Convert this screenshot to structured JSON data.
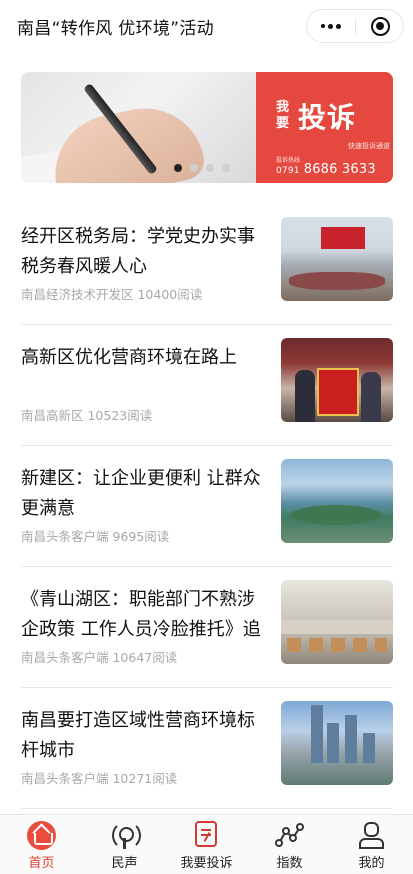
{
  "header": {
    "title": "南昌“转作风 优环境”活动"
  },
  "banner": {
    "wo_yao": "我要",
    "tousu": "投诉",
    "subtitle": "快速投诉通道",
    "hotline_label": "投诉热线",
    "area_code": "0791",
    "phone": "8686 3633",
    "carousel_total": 4,
    "carousel_active": 1
  },
  "news": [
    {
      "title": "经开区税务局：学党史办实事 税务春风暖人心",
      "meta": "南昌经济技术开发区 10400阅读"
    },
    {
      "title": "高新区优化营商环境在路上",
      "meta": "南昌高新区 10523阅读"
    },
    {
      "title": "新建区：让企业更便利 让群众更满意",
      "meta": "南昌头条客户端 9695阅读"
    },
    {
      "title": "《青山湖区：职能部门不熟涉企政策 工作人员冷脸推托》追",
      "meta": "南昌头条客户端 10647阅读"
    },
    {
      "title": "南昌要打造区域性营商环境标杆城市",
      "meta": "南昌头条客户端 10271阅读"
    }
  ],
  "tabbar": {
    "tabs": [
      {
        "label": "首页",
        "icon": "home-icon"
      },
      {
        "label": "民声",
        "icon": "broadcast-icon"
      },
      {
        "label": "我要投诉",
        "icon": "complaint-form-icon"
      },
      {
        "label": "指数",
        "icon": "index-chart-icon"
      },
      {
        "label": "我的",
        "icon": "profile-icon"
      }
    ],
    "active_index": 0
  },
  "colors": {
    "accent": "#e23d31",
    "banner_red": "#e5483e"
  }
}
